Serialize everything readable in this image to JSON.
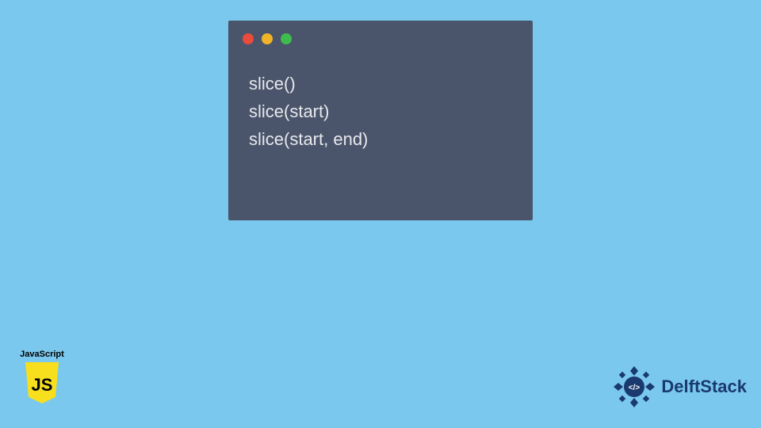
{
  "code": {
    "lines": [
      "slice()",
      "slice(start)",
      "slice(start, end)"
    ]
  },
  "badges": {
    "js_label": "JavaScript",
    "js_letters": "JS",
    "delft_name": "DelftStack",
    "delft_glyph": "</>"
  },
  "colors": {
    "bg": "#7ac8ed",
    "window": "#4a556b",
    "traffic_red": "#e94b3c",
    "traffic_yellow": "#f0b429",
    "traffic_green": "#3ebd4e",
    "js_yellow": "#f7df1e",
    "delft_blue": "#1a3a6e"
  }
}
